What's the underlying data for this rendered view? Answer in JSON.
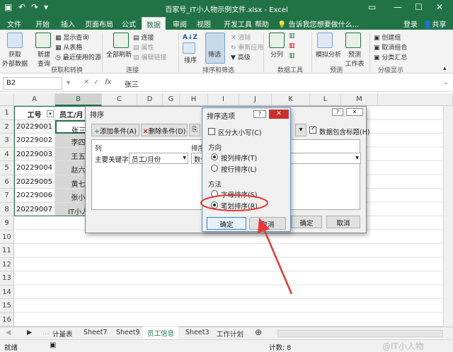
{
  "titlebar": {
    "title": "百家号_IT小人物示例文件.xlsx - Excel",
    "login": "登录",
    "share": "共享"
  },
  "tabs": [
    "文件",
    "开始",
    "插入",
    "页面布局",
    "公式",
    "数据",
    "审阅",
    "视图",
    "开发工具",
    "帮助",
    "告诉我您想要做什么..."
  ],
  "active_tab": "数据",
  "ribbon": {
    "get_external": "获取\n外部数据",
    "new_query": "新建\n查询",
    "show_queries": "显示查询",
    "from_table": "从表格",
    "recent_sources": "最近使用的源",
    "group_get": "获取和转换",
    "refresh_all": "全部刷新",
    "connections": "连接",
    "properties": "属性",
    "edit_links": "编辑链接",
    "group_conn": "连接",
    "sort_az": "A↓Z",
    "sort": "排序",
    "filter": "筛选",
    "clear": "清除",
    "reapply": "重新应用",
    "advanced": "高级",
    "group_sort": "排序和筛选",
    "text_to_cols": "分列",
    "group_tools": "数据工具",
    "what_if": "模拟分析",
    "forecast": "预测\n工作表",
    "group_forecast": "预测",
    "group": "创建组",
    "ungroup": "取消组合",
    "subtotal": "分类汇总",
    "group_outline": "分级显示"
  },
  "formula_bar": {
    "name_box": "B2",
    "fx": "fx",
    "value": "张三"
  },
  "columns": [
    "A",
    "B",
    "C",
    "D",
    "G",
    "H",
    "I",
    "J",
    "K",
    "L",
    "M"
  ],
  "rows": [
    "1",
    "2",
    "3",
    "4",
    "5",
    "6",
    "7",
    "8",
    "9",
    "10",
    "11",
    "12",
    "13",
    "14",
    "15",
    "16"
  ],
  "table": {
    "header": [
      "工号",
      "员工/月"
    ],
    "rows": [
      [
        "20229001",
        "张三"
      ],
      [
        "20229002",
        "李四"
      ],
      [
        "20229003",
        "王五"
      ],
      [
        "20229004",
        "赵六"
      ],
      [
        "20229005",
        "黄七"
      ],
      [
        "20229006",
        "张小"
      ],
      [
        "20229007",
        "IT小人"
      ]
    ]
  },
  "sort_dialog": {
    "title": "排序",
    "add_level": "添加条件(A)",
    "delete_level": "删除条件(D)",
    "has_headers": "数据包含标题(H)",
    "col_header": "列",
    "sort_on_header": "排序",
    "primary_key_label": "主要关键字",
    "primary_key_value": "员工/月份",
    "sort_on_value": "数值",
    "ok": "确定",
    "cancel": "取消"
  },
  "options_dialog": {
    "title": "排序选项",
    "help": "?",
    "case_sensitive": "区分大小写(C)",
    "orientation_label": "方向",
    "top_to_bottom": "按列排序(T)",
    "left_to_right": "按行排序(L)",
    "method_label": "方法",
    "alphabetic": "字母排序(S)",
    "stroke": "笔划排序(R)",
    "ok": "确定",
    "cancel": "取消"
  },
  "sheets": [
    "计量表",
    "Sheet7",
    "Sheet9",
    "员工信息",
    "Sheet3",
    "工作计划"
  ],
  "active_sheet": "员工信息",
  "status": {
    "ready": "就绪",
    "count": "计数: 8",
    "watermark": "@IT小人物"
  },
  "colors": {
    "excel_green": "#217346",
    "highlight": "#e53935"
  }
}
